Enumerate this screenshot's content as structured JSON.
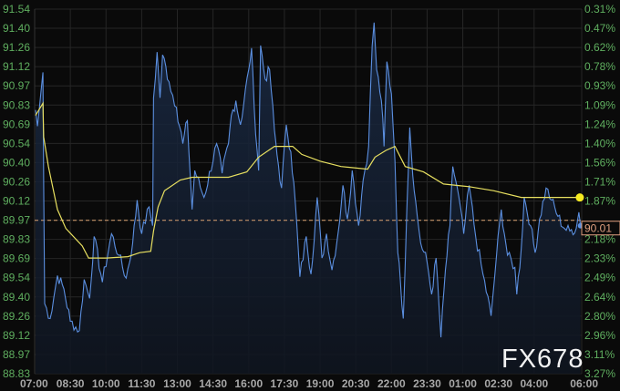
{
  "chart_data": {
    "type": "line",
    "title": "",
    "watermark": "FX678",
    "ylim": [
      88.83,
      91.54
    ],
    "xlim_hours_from_start": [
      0,
      23
    ],
    "y_ticks": [
      "91.54",
      "91.40",
      "91.26",
      "91.12",
      "90.97",
      "90.83",
      "90.69",
      "90.54",
      "90.40",
      "90.26",
      "90.12",
      "89.97",
      "89.83",
      "89.69",
      "89.54",
      "89.40",
      "89.26",
      "89.12",
      "88.97",
      "88.83"
    ],
    "y_right_ticks": [
      "0.31%",
      "0.47%",
      "0.62%",
      "0.78%",
      "0.93%",
      "1.09%",
      "1.24%",
      "1.40%",
      "1.56%",
      "1.71%",
      "1.87%",
      "",
      "2.18%",
      "2.33%",
      "2.49%",
      "2.64%",
      "2.80%",
      "2.96%",
      "3.11%",
      "3.27%"
    ],
    "x_ticks": [
      {
        "label": "07:00",
        "h": 0
      },
      {
        "label": "08:30",
        "h": 1.5
      },
      {
        "label": "10:00",
        "h": 3
      },
      {
        "label": "11:30",
        "h": 4.5
      },
      {
        "label": "13:00",
        "h": 6
      },
      {
        "label": "14:30",
        "h": 7.5
      },
      {
        "label": "16:00",
        "h": 9
      },
      {
        "label": "17:30",
        "h": 10.5
      },
      {
        "label": "19:00",
        "h": 12
      },
      {
        "label": "20:30",
        "h": 13.5
      },
      {
        "label": "22:00",
        "h": 15
      },
      {
        "label": "23:30",
        "h": 16.5
      },
      {
        "label": "01:00",
        "h": 18
      },
      {
        "label": "02:30",
        "h": 19.5
      },
      {
        "label": "04:00",
        "h": 21
      },
      {
        "label": "06:00",
        "h": 23
      }
    ],
    "reference_line": 89.97,
    "last_price_label": "90.01",
    "colors": {
      "price": "#5b8fe0",
      "average": "#e8e060",
      "reference": "#d9a070",
      "tag": "#e0a080"
    },
    "series": [
      {
        "name": "price",
        "points": [
          [
            0.04,
            90.79
          ],
          [
            0.12,
            90.67
          ],
          [
            0.27,
            90.93
          ],
          [
            0.35,
            91.07
          ],
          [
            0.38,
            90.25
          ],
          [
            0.42,
            89.35
          ],
          [
            0.65,
            89.24
          ],
          [
            0.96,
            89.56
          ],
          [
            1.23,
            89.46
          ],
          [
            1.5,
            89.22
          ],
          [
            1.88,
            89.15
          ],
          [
            2.08,
            89.53
          ],
          [
            2.31,
            89.39
          ],
          [
            2.5,
            89.85
          ],
          [
            2.85,
            89.51
          ],
          [
            3.23,
            89.87
          ],
          [
            3.54,
            89.71
          ],
          [
            3.85,
            89.54
          ],
          [
            4.12,
            89.8
          ],
          [
            4.31,
            90.12
          ],
          [
            4.5,
            89.87
          ],
          [
            4.81,
            90.07
          ],
          [
            4.96,
            89.93
          ],
          [
            5.0,
            90.88
          ],
          [
            5.15,
            91.22
          ],
          [
            5.27,
            90.88
          ],
          [
            5.38,
            91.2
          ],
          [
            5.65,
            91.0
          ],
          [
            5.96,
            90.81
          ],
          [
            6.23,
            90.54
          ],
          [
            6.42,
            90.71
          ],
          [
            6.62,
            90.05
          ],
          [
            6.73,
            90.34
          ],
          [
            7.12,
            90.14
          ],
          [
            7.65,
            90.54
          ],
          [
            7.88,
            90.32
          ],
          [
            8.15,
            90.54
          ],
          [
            8.27,
            90.75
          ],
          [
            8.46,
            90.86
          ],
          [
            8.65,
            90.68
          ],
          [
            9.0,
            91.09
          ],
          [
            9.12,
            91.25
          ],
          [
            9.23,
            90.81
          ],
          [
            9.42,
            90.34
          ],
          [
            9.5,
            91.27
          ],
          [
            9.69,
            91.02
          ],
          [
            9.88,
            91.09
          ],
          [
            10.08,
            90.64
          ],
          [
            10.19,
            90.46
          ],
          [
            10.38,
            90.21
          ],
          [
            10.58,
            90.68
          ],
          [
            10.77,
            90.48
          ],
          [
            10.96,
            90.1
          ],
          [
            11.15,
            89.55
          ],
          [
            11.42,
            89.85
          ],
          [
            11.62,
            89.57
          ],
          [
            11.88,
            90.14
          ],
          [
            12.08,
            89.69
          ],
          [
            12.27,
            89.87
          ],
          [
            12.5,
            89.6
          ],
          [
            12.77,
            89.89
          ],
          [
            12.96,
            90.23
          ],
          [
            13.15,
            89.98
          ],
          [
            13.35,
            90.34
          ],
          [
            13.62,
            89.93
          ],
          [
            13.81,
            90.27
          ],
          [
            14.04,
            90.52
          ],
          [
            14.19,
            91.27
          ],
          [
            14.27,
            91.44
          ],
          [
            14.38,
            91.09
          ],
          [
            14.58,
            90.86
          ],
          [
            14.69,
            90.52
          ],
          [
            14.81,
            91.15
          ],
          [
            15.0,
            90.91
          ],
          [
            15.15,
            90.41
          ],
          [
            15.27,
            89.73
          ],
          [
            15.38,
            89.51
          ],
          [
            15.5,
            89.24
          ],
          [
            15.65,
            90.07
          ],
          [
            15.77,
            90.66
          ],
          [
            15.96,
            90.19
          ],
          [
            16.15,
            89.91
          ],
          [
            16.23,
            89.8
          ],
          [
            16.5,
            89.66
          ],
          [
            16.69,
            89.42
          ],
          [
            16.88,
            89.69
          ],
          [
            17.08,
            89.1
          ],
          [
            17.27,
            89.6
          ],
          [
            17.46,
            89.93
          ],
          [
            17.58,
            90.37
          ],
          [
            17.77,
            90.21
          ],
          [
            18.04,
            89.87
          ],
          [
            18.27,
            90.23
          ],
          [
            18.54,
            89.85
          ],
          [
            18.85,
            89.57
          ],
          [
            19.19,
            89.26
          ],
          [
            19.42,
            89.71
          ],
          [
            19.62,
            90.05
          ],
          [
            19.88,
            89.71
          ],
          [
            20.19,
            89.62
          ],
          [
            20.27,
            89.42
          ],
          [
            20.46,
            89.76
          ],
          [
            20.58,
            90.14
          ],
          [
            20.85,
            89.93
          ],
          [
            21.04,
            89.73
          ],
          [
            21.23,
            89.98
          ],
          [
            21.5,
            90.21
          ],
          [
            21.73,
            90.12
          ],
          [
            22.0,
            90.0
          ],
          [
            22.27,
            89.91
          ],
          [
            22.5,
            89.89
          ],
          [
            22.77,
            89.91
          ],
          [
            22.88,
            90.03
          ],
          [
            22.95,
            89.93
          ]
        ]
      },
      {
        "name": "average",
        "points": [
          [
            0.04,
            90.75
          ],
          [
            0.35,
            90.84
          ],
          [
            0.38,
            90.59
          ],
          [
            0.58,
            90.37
          ],
          [
            0.96,
            90.05
          ],
          [
            1.31,
            89.91
          ],
          [
            2.0,
            89.78
          ],
          [
            2.27,
            89.69
          ],
          [
            3.04,
            89.69
          ],
          [
            3.92,
            89.7
          ],
          [
            4.42,
            89.73
          ],
          [
            4.88,
            89.74
          ],
          [
            5.0,
            89.89
          ],
          [
            5.19,
            90.07
          ],
          [
            5.46,
            90.19
          ],
          [
            6.12,
            90.27
          ],
          [
            6.62,
            90.29
          ],
          [
            8.15,
            90.29
          ],
          [
            8.92,
            90.33
          ],
          [
            9.42,
            90.44
          ],
          [
            10.08,
            90.52
          ],
          [
            10.85,
            90.52
          ],
          [
            11.23,
            90.46
          ],
          [
            12.0,
            90.41
          ],
          [
            12.88,
            90.37
          ],
          [
            14.0,
            90.35
          ],
          [
            14.31,
            90.44
          ],
          [
            14.77,
            90.49
          ],
          [
            15.15,
            90.52
          ],
          [
            15.58,
            90.37
          ],
          [
            16.35,
            90.33
          ],
          [
            17.19,
            90.24
          ],
          [
            18.27,
            90.22
          ],
          [
            19.31,
            90.19
          ],
          [
            20.46,
            90.14
          ],
          [
            21.5,
            90.14
          ],
          [
            22.92,
            90.14
          ]
        ]
      }
    ]
  }
}
